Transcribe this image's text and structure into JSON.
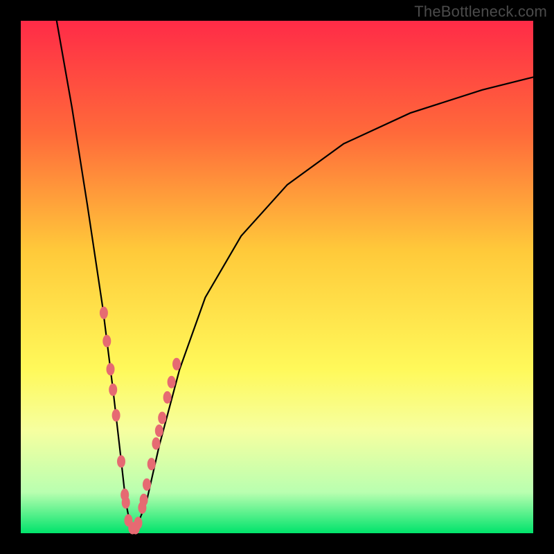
{
  "watermark": "TheBottleneck.com",
  "gradient": {
    "stops": [
      {
        "pct": 0,
        "color": "#ff2b47"
      },
      {
        "pct": 22,
        "color": "#ff6a3a"
      },
      {
        "pct": 45,
        "color": "#ffca3a"
      },
      {
        "pct": 68,
        "color": "#fff95a"
      },
      {
        "pct": 80,
        "color": "#f6ffa0"
      },
      {
        "pct": 92,
        "color": "#b9ffb0"
      },
      {
        "pct": 100,
        "color": "#00e36b"
      }
    ]
  },
  "chart_data": {
    "type": "line",
    "title": "",
    "xlabel": "",
    "ylabel": "",
    "x_range": [
      0,
      100
    ],
    "y_range": [
      0,
      100
    ],
    "y_meaning": "percent bottleneck (0 = ideal, 100 = worst)",
    "series": [
      {
        "name": "bottleneck-curve",
        "x": [
          7,
          10,
          13,
          16,
          18,
          19.5,
          20.5,
          21.5,
          22.5,
          24.5,
          27,
          31,
          36,
          43,
          52,
          63,
          76,
          90,
          100
        ],
        "y": [
          100,
          83,
          64,
          44,
          28,
          15,
          6,
          1,
          1,
          6,
          17,
          32,
          46,
          58,
          68,
          76,
          82,
          86.5,
          89
        ]
      }
    ],
    "sample_points": {
      "name": "benchmark-samples",
      "x": [
        16.2,
        16.8,
        17.5,
        18.0,
        18.6,
        19.6,
        20.3,
        20.5,
        21.0,
        21.8,
        22.4,
        22.9,
        23.7,
        24.0,
        24.6,
        25.5,
        26.4,
        27.0,
        27.6,
        28.6,
        29.4,
        30.4
      ],
      "y": [
        43.0,
        37.5,
        32.0,
        28.0,
        23.0,
        14.0,
        7.5,
        6.0,
        2.5,
        1.0,
        1.0,
        2.0,
        5.0,
        6.5,
        9.5,
        13.5,
        17.5,
        20.0,
        22.5,
        26.5,
        29.5,
        33.0
      ]
    },
    "annotations": []
  }
}
